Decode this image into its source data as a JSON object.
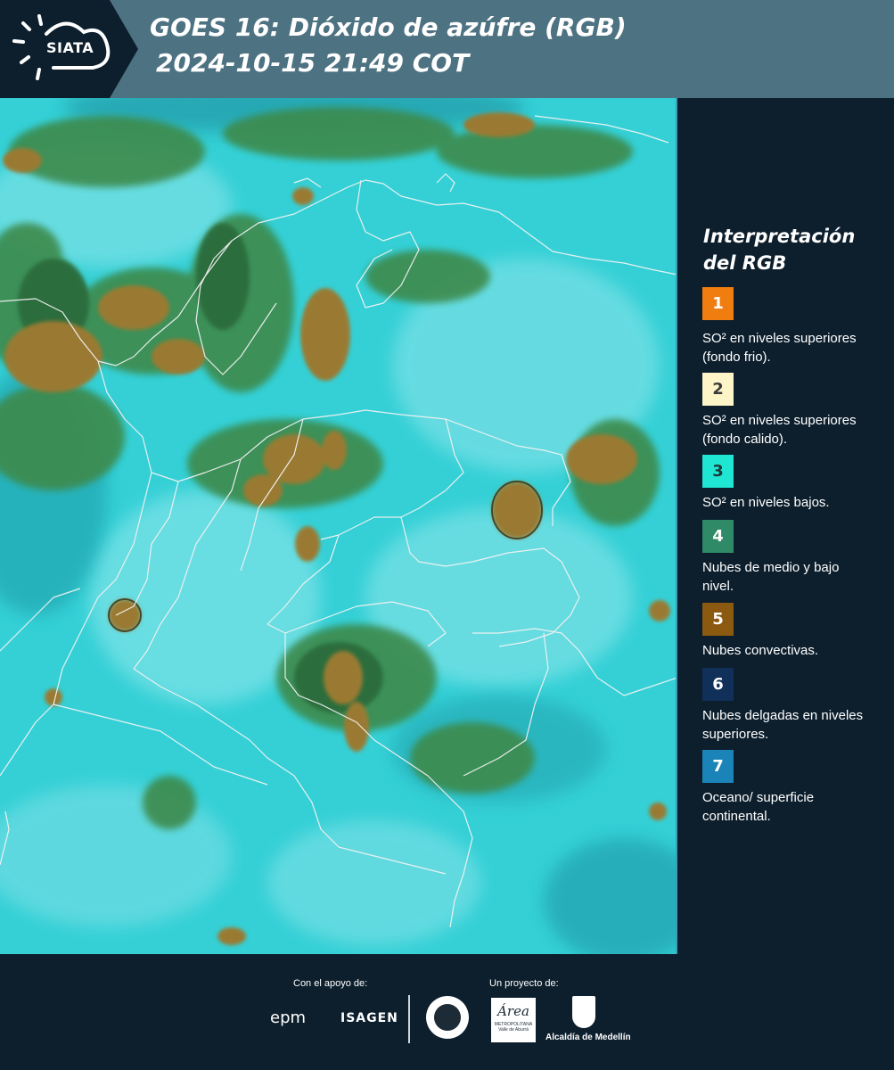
{
  "header": {
    "logo_text": "SIATA",
    "title_line1": "GOES 16: Dióxido de azúfre (RGB)",
    "title_line2": "2024-10-15 21:49 COT"
  },
  "legend": {
    "title": "Interpretación del RGB",
    "items": [
      {
        "num": "1",
        "color": "#f07d10",
        "text": "SO² en niveles superiores (fondo frio)."
      },
      {
        "num": "2",
        "color": "#fdf5c8",
        "text": "SO² en niveles superiores (fondo calido)."
      },
      {
        "num": "3",
        "color": "#1fe6d2",
        "text": "SO² en niveles bajos."
      },
      {
        "num": "4",
        "color": "#2f8a68",
        "text": "Nubes de medio y bajo nivel."
      },
      {
        "num": "5",
        "color": "#8b5a10",
        "text": "Nubes convectivas."
      },
      {
        "num": "6",
        "color": "#10305a",
        "text": "Nubes delgadas en niveles superiores."
      },
      {
        "num": "7",
        "color": "#1a84b8",
        "text": "Oceano/ superficie continental."
      }
    ]
  },
  "footer": {
    "support_label": "Con el apoyo de:",
    "project_label": "Un proyecto de:",
    "sponsors": [
      "epm",
      "ISAGEN"
    ],
    "partners": [
      "Área Metropolitana Valle de Aburrá",
      "Alcaldía de Medellín"
    ],
    "area_word": "Área",
    "area_sub": "METROPOLITANA Valle de Aburrá",
    "alcaldia_text": "Alcaldía de Medellín"
  },
  "colors": {
    "header_bg": "#4d7282",
    "panel_bg": "#0d1f2d",
    "map_base": "#33d2d6",
    "cloud_green": "#3e8a4c",
    "cloud_brown": "#9c7a30"
  }
}
